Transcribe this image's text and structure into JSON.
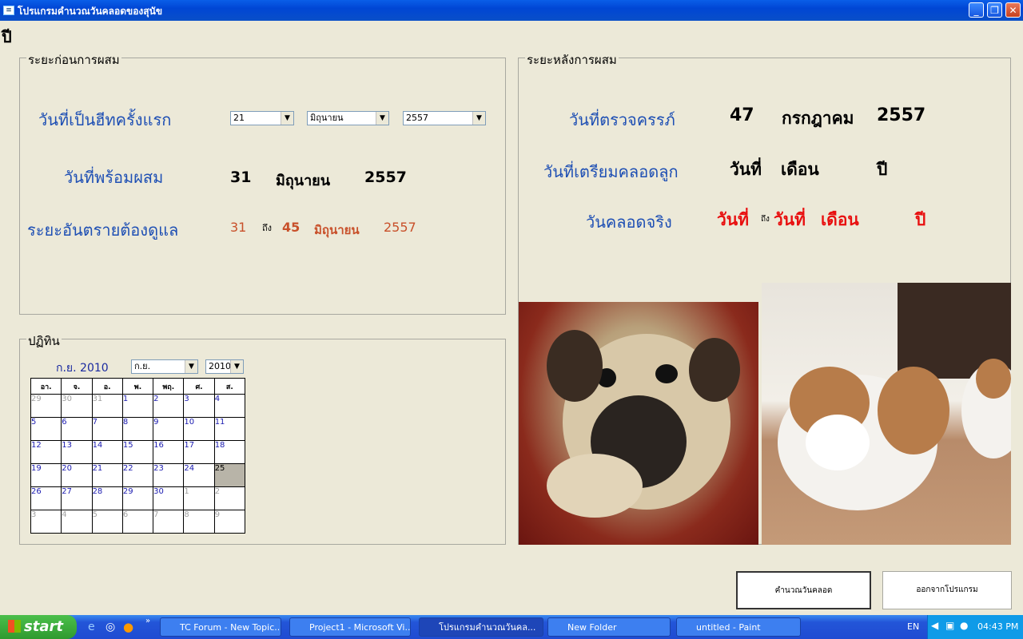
{
  "window": {
    "title": "โปรแกรมคำนวณวันคลอดของสุนัข",
    "year_glyph": "ปี"
  },
  "before": {
    "title": "ระยะก่อนการผสม",
    "first_heat_label": "วันที่เป็นฮีทครั้งแรก",
    "day_value": "21",
    "month_value": "มิถุนายน",
    "year_value": "2557",
    "ready_label": "วันที่พร้อมผสม",
    "ready_day": "31",
    "ready_month": "มิถุนายน",
    "ready_year": "2557",
    "danger_label": "ระยะอันตรายต้องดูแล",
    "danger_from": "31",
    "danger_to_word": "ถึง",
    "danger_to": "45",
    "danger_month": "มิถุนายน",
    "danger_year": "2557"
  },
  "after": {
    "title": "ระยะหลังการผสม",
    "check_label": "วันที่ตรวจครรภ์",
    "check_day": "47",
    "check_month": "กรกฎาคม",
    "check_year": "2557",
    "prepare_label": "วันที่เตรียมคลอดลูก",
    "prepare_day": "วันที่",
    "prepare_month": "เดือน",
    "prepare_year": "ปี",
    "actual_label": "วันคลอดจริง",
    "actual_from": "วันที่",
    "actual_to_word": "ถึง",
    "actual_to": "วันที่",
    "actual_month": "เดือน",
    "actual_year": "ปี"
  },
  "calendar": {
    "title": "ปฏิทิน",
    "heading": "ก.ย. 2010",
    "month_select": "ก.ย.",
    "year_select": "2010",
    "weekdays": [
      "อา.",
      "จ.",
      "อ.",
      "พ.",
      "พฤ.",
      "ศ.",
      "ส."
    ],
    "weeks": [
      [
        "29",
        "30",
        "31",
        "1",
        "2",
        "3",
        "4"
      ],
      [
        "5",
        "6",
        "7",
        "8",
        "9",
        "10",
        "11"
      ],
      [
        "12",
        "13",
        "14",
        "15",
        "16",
        "17",
        "18"
      ],
      [
        "19",
        "20",
        "21",
        "22",
        "23",
        "24",
        "25"
      ],
      [
        "26",
        "27",
        "28",
        "29",
        "30",
        "1",
        "2"
      ],
      [
        "3",
        "4",
        "5",
        "6",
        "7",
        "8",
        "9"
      ]
    ],
    "selected": "25"
  },
  "buttons": {
    "calculate": "คำนวณวันคลอด",
    "exit": "ออกจากโปรแกรม"
  },
  "taskbar": {
    "start": "start",
    "items": [
      "TC Forum - New Topic...",
      "Project1 - Microsoft Vi...",
      "โปรแกรมคำนวณวันคล...",
      "New Folder",
      "untitled - Paint"
    ],
    "lang": "EN",
    "clock": "04:43 PM"
  },
  "colors": {
    "label_blue": "#1e4fb4",
    "orange": "#c8502a",
    "red": "#e81010"
  }
}
